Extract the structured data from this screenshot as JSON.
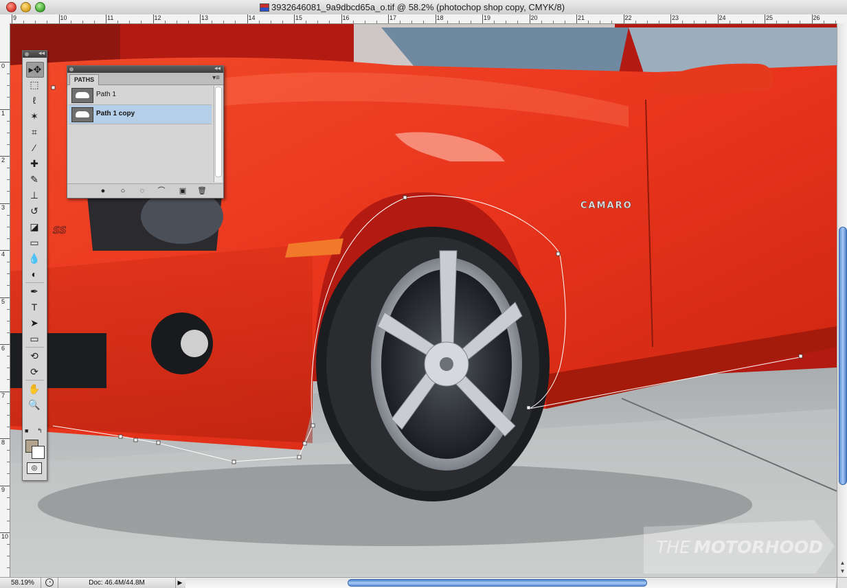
{
  "window": {
    "title": "3932646081_9a9dbcd65a_o.tif @ 58.2% (photochop shop copy, CMYK/8)"
  },
  "rulers": {
    "top": [
      "9",
      "10",
      "11",
      "12",
      "13",
      "14",
      "15",
      "16",
      "17",
      "18",
      "19",
      "20",
      "21",
      "22",
      "23",
      "24",
      "25",
      "26"
    ],
    "left": [
      "0",
      "1",
      "2",
      "3",
      "4",
      "5",
      "6",
      "7",
      "8",
      "9",
      "10"
    ]
  },
  "tools": {
    "items": [
      {
        "name": "move-tool",
        "glyph": "▸✥"
      },
      {
        "name": "marquee-tool",
        "glyph": "⬚"
      },
      {
        "name": "lasso-tool",
        "glyph": "ℓ"
      },
      {
        "name": "magic-wand-tool",
        "glyph": "✶"
      },
      {
        "name": "crop-tool",
        "glyph": "⌗"
      },
      {
        "name": "eyedropper-tool",
        "glyph": "⁄"
      },
      {
        "name": "healing-brush-tool",
        "glyph": "✚"
      },
      {
        "name": "brush-tool",
        "glyph": "✎"
      },
      {
        "name": "clone-stamp-tool",
        "glyph": "⊥"
      },
      {
        "name": "history-brush-tool",
        "glyph": "↺"
      },
      {
        "name": "eraser-tool",
        "glyph": "◪"
      },
      {
        "name": "gradient-tool",
        "glyph": "▭"
      },
      {
        "name": "blur-tool",
        "glyph": "💧"
      },
      {
        "name": "dodge-tool",
        "glyph": "◐"
      },
      {
        "name": "pen-tool",
        "glyph": "✒"
      },
      {
        "name": "type-tool",
        "glyph": "T"
      },
      {
        "name": "path-selection-tool",
        "glyph": "➤"
      },
      {
        "name": "rectangle-tool",
        "glyph": "▭"
      },
      {
        "name": "3d-rotate-tool",
        "glyph": "⟲"
      },
      {
        "name": "3d-orbit-tool",
        "glyph": "⟳"
      },
      {
        "name": "hand-tool",
        "glyph": "✋"
      },
      {
        "name": "zoom-tool",
        "glyph": "🔍"
      }
    ],
    "colors": {
      "foreground": "#b2a48c",
      "background": "#ffffff"
    }
  },
  "paths_panel": {
    "tab_label": "PATHS",
    "paths": [
      {
        "name": "Path 1",
        "selected": false
      },
      {
        "name": "Path 1 copy",
        "selected": true
      }
    ],
    "footer_buttons": [
      "fill-path-icon",
      "stroke-path-icon",
      "load-selection-icon",
      "make-work-path-icon",
      "new-path-icon",
      "delete-path-icon"
    ]
  },
  "canvas": {
    "badge_text": "CAMARO",
    "emblem_text": "SS",
    "watermark": {
      "light": "THE",
      "bold": "MOTORHOOD"
    }
  },
  "status": {
    "zoom": "58.19%",
    "doc_size": "Doc: 46.4M/44.8M"
  },
  "colors": {
    "car_paint": "#e8341c",
    "selection_highlight": "#b6cfe9",
    "scroll_thumb": "#5b8fd9"
  }
}
